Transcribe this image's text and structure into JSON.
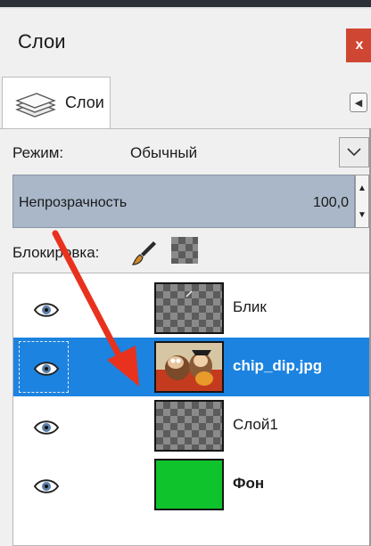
{
  "panel": {
    "title": "Слои",
    "close_label": "x"
  },
  "tabs": [
    {
      "label": "Слои",
      "icon": "layers-stack-icon"
    }
  ],
  "tab_menu_icon": "triangle-left-icon",
  "mode": {
    "label": "Режим:",
    "value": "Обычный"
  },
  "opacity": {
    "label": "Непрозрачность",
    "value": "100,0",
    "percent": 100
  },
  "lock": {
    "label": "Блокировка:",
    "icons": [
      "paintbrush-icon",
      "alpha-checker-icon"
    ]
  },
  "layers": [
    {
      "name": "Блик",
      "visible": true,
      "selected": false,
      "thumbnail": "transparent-checker"
    },
    {
      "name": "chip_dip.jpg",
      "visible": true,
      "selected": true,
      "thumbnail": "photo"
    },
    {
      "name": "Слой1",
      "visible": true,
      "selected": false,
      "thumbnail": "transparent-checker"
    },
    {
      "name": "Фон",
      "visible": true,
      "selected": false,
      "thumbnail": "green-fill"
    }
  ],
  "colors": {
    "selection": "#1c83e0",
    "close_button": "#cf4733",
    "opacity_bar": "#a9b7c9",
    "annotation_arrow": "#e8321e",
    "background_layer_fill": "#0ec32b"
  }
}
